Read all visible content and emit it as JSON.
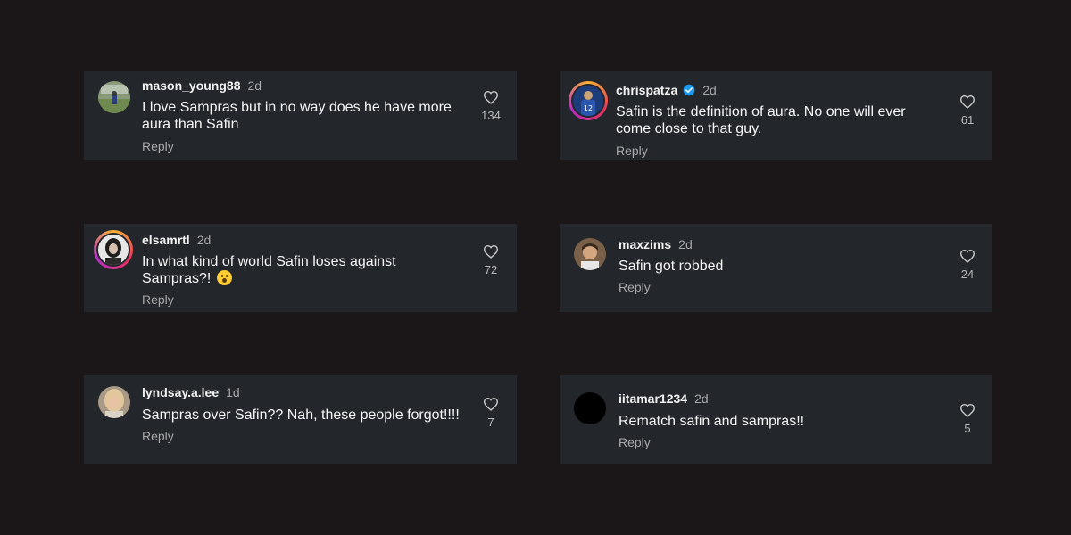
{
  "comments": [
    {
      "username": "mason_young88",
      "time": "2d",
      "text": "I love Sampras but in no way does he have more aura than Safin",
      "reply": "Reply",
      "likes": "134"
    },
    {
      "username": "chrispatza",
      "verified": true,
      "time": "2d",
      "text": "Safin is the definition of aura. No one will ever come close to that guy.",
      "reply": "Reply",
      "likes": "61"
    },
    {
      "username": "elsamrtl",
      "time": "2d",
      "text": "In what kind of world Safin loses against Sampras?!",
      "emoji": "astonished-face",
      "reply": "Reply",
      "likes": "72"
    },
    {
      "username": "maxzims",
      "time": "2d",
      "text": "Safin got robbed",
      "reply": "Reply",
      "likes": "24"
    },
    {
      "username": "lyndsay.a.lee",
      "time": "1d",
      "text": "Sampras over Safin?? Nah, these people forgot!!!!",
      "reply": "Reply",
      "likes": "7"
    },
    {
      "username": "iitamar1234",
      "time": "2d",
      "text": "Rematch safin and sampras!!",
      "reply": "Reply",
      "likes": "5"
    }
  ],
  "colors": {
    "page_background": "#1b1618",
    "card_background": "#23262b",
    "verified_badge": "#1d9bf0"
  },
  "icons": {
    "like": "heart-outline-icon",
    "verified": "verified-badge-icon"
  }
}
